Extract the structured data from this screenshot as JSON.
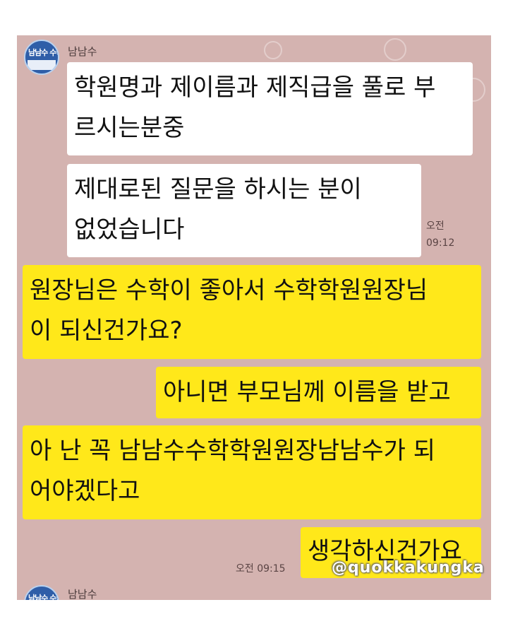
{
  "top_sender": {
    "name": "남남수",
    "avatar_text": "남남수 수학"
  },
  "messages_received": [
    {
      "text": "학원명과 제이름과 제직급을 풀로 부\n르시는분중"
    },
    {
      "text": "제대로된 질문을 하시는 분이\n없었습니다"
    }
  ],
  "received_timestamp": "오전\n09:12",
  "messages_sent": [
    {
      "text": "원장님은 수학이 좋아서 수학학원원장님\n이 되신건가요?"
    },
    {
      "text": "아니면 부모님께 이름을 받고"
    },
    {
      "text": "아 난 꼭 남남수수학학원원장남남수가 되\n어야겠다고"
    },
    {
      "text": "생각하신건가요"
    }
  ],
  "sent_timestamp": "오전 09:15",
  "bottom_sender": {
    "name": "남남수"
  },
  "watermark": "@quokkakungka",
  "colors": {
    "chat_background": "#d4b3b0",
    "sent_bubble": "#ffe81a",
    "received_bubble": "#ffffff"
  }
}
